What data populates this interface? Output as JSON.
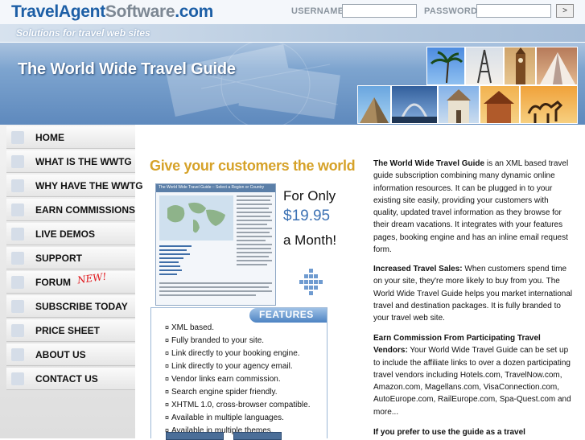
{
  "header": {
    "logo_part1": "TravelAgent",
    "logo_part2": "Software",
    "logo_part3": ".com",
    "username_label": "USERNAME:",
    "password_label": "PASSWORD:",
    "go_label": ">"
  },
  "banner": {
    "tagline": "Solutions for travel web sites",
    "title": "The World Wide Travel Guide"
  },
  "nav": {
    "items": [
      {
        "label": "HOME"
      },
      {
        "label": "WHAT IS THE WWTG"
      },
      {
        "label": "WHY HAVE THE WWTG"
      },
      {
        "label": "EARN COMMISSIONS"
      },
      {
        "label": "LIVE DEMOS"
      },
      {
        "label": "SUPPORT"
      },
      {
        "label": "FORUM"
      },
      {
        "label": "SUBSCRIBE TODAY"
      },
      {
        "label": "PRICE SHEET"
      },
      {
        "label": "ABOUT US"
      },
      {
        "label": "CONTACT US"
      }
    ],
    "new_badge": "NEW!"
  },
  "promo": {
    "headline": "Give your customers the world",
    "price_line1": "For Only",
    "price": "$19.95",
    "price_line3": "a Month!",
    "screenshot_title": "The World Wide Travel Guide :: Select a Region or Country"
  },
  "features": {
    "title": "FEATURES",
    "items": [
      "XML based.",
      "Fully branded to your site.",
      "Link directly to your booking engine.",
      "Link directly to your agency email.",
      "Vendor links earn commission.",
      "Search engine spider friendly.",
      "XHTML 1.0, cross-browser compatible.",
      "Available in multiple languages.",
      "Available in multiple themes."
    ]
  },
  "content": {
    "p1_bold": "The World Wide Travel Guide",
    "p1_text": " is an XML based travel guide subscription combining many dynamic online information resources. It can be plugged in to your existing site easily, providing your customers with quality, updated travel information as they browse for their dream vacations. It integrates with your features pages, booking engine and has an inline email request form.",
    "p2_bold": "Increased Travel Sales:",
    "p2_text": " When customers spend time on your site, they're more likely to buy from you. The World Wide Travel Guide helps you market international travel and destination packages. It is fully branded to your travel web site.",
    "p3_bold": "Earn Commission From Participating Travel Vendors:",
    "p3_text": " Your World Wide Travel Guide can be set up to include the affiliate links to over a dozen participating travel vendors including Hotels.com, TravelNow.com, Amazon.com, Magellans.com, VisaConnection.com, AutoEurope.com, RailEurope.com, Spa-Quest.com and more...",
    "p4_bold": "If you prefer to use the guide as a travel"
  },
  "colors": {
    "brand_blue": "#1d5fa6",
    "headline_gold": "#d6a229",
    "price_blue": "#3d72b4",
    "new_red": "#e0161b"
  }
}
